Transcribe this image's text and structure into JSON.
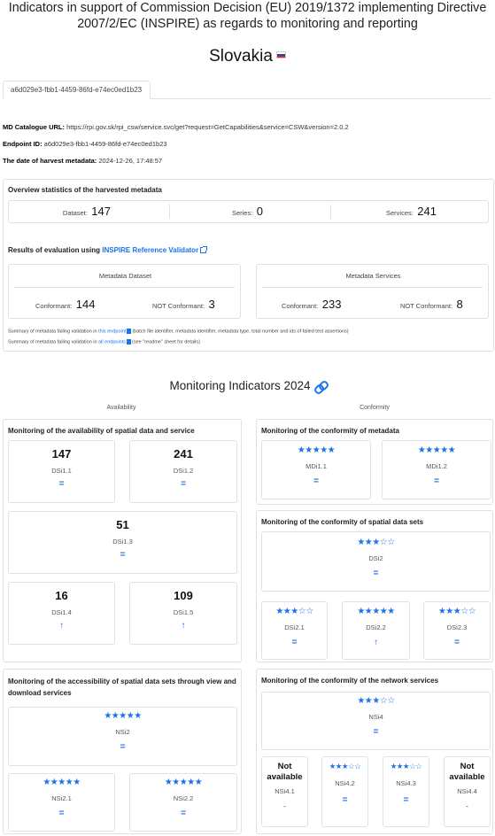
{
  "page": {
    "title": "Indicators in support of Commission Decision (EU) 2019/1372 implementing Directive 2007/2/EC (INSPIRE) as regards to monitoring and reporting",
    "country": "Slovakia"
  },
  "tab": {
    "label": "a6d029e3-fbb1-4459-86fd-e74ec0ed1b23"
  },
  "meta": {
    "md_catalogue_label": "MD Catalogue URL:",
    "md_catalogue_value": "https://rpi.gov.sk/rpi_csw/service.svc/get?request=GetCapabilities&service=CSW&version=2.0.2",
    "endpoint_label": "Endpoint ID:",
    "endpoint_value": "a6d029e3-fbb1-4459-86fd-e74ec0ed1b23",
    "harvest_label": "The date of harvest metadata:",
    "harvest_value": "2024-12-26, 17:48:57"
  },
  "overview": {
    "title": "Overview statistics of the harvested metadata",
    "dataset_label": "Dataset:",
    "dataset_value": "147",
    "series_label": "Series:",
    "series_value": "0",
    "services_label": "Services:",
    "services_value": "241"
  },
  "evaluation": {
    "title_prefix": "Results of evaluation using",
    "validator_link": "INSPIRE Reference Validator",
    "md_dataset": {
      "title": "Metadata Dataset",
      "conf_label": "Conformant:",
      "conf_value": "144",
      "nconf_label": "NOT Conformant:",
      "nconf_value": "3"
    },
    "md_services": {
      "title": "Metadata Services",
      "conf_label": "Conformant:",
      "conf_value": "233",
      "nconf_label": "NOT Conformant:",
      "nconf_value": "8"
    },
    "summary1_prefix": "Summary of metadata failing validation in",
    "summary1_link": "this endpoint",
    "summary1_suffix": "(batch file identifier, metadata identifier, metadata type, total number and ids of failed test assertions)",
    "summary2_prefix": "Summary of metadata failing validation in",
    "summary2_link": "all endpoints",
    "summary2_suffix": "(see \"readme\" sheet for details)"
  },
  "monitoring": {
    "title": "Monitoring Indicators 2024",
    "col_availability": "Availability",
    "col_conformity": "Conformity",
    "avail": {
      "title": "Monitoring of the availability of spatial data and service",
      "dsi11": {
        "value": "147",
        "name": "DSi1.1",
        "trend": "="
      },
      "dsi12": {
        "value": "241",
        "name": "DSi1.2",
        "trend": "="
      },
      "dsi13": {
        "value": "51",
        "name": "DSi1.3",
        "trend": "="
      },
      "dsi14": {
        "value": "16",
        "name": "DSi1.4",
        "trend": "↑"
      },
      "dsi15": {
        "value": "109",
        "name": "DSi1.5",
        "trend": "↑"
      }
    },
    "access": {
      "title": "Monitoring of the accessibility of spatial data sets through view and download services",
      "nsi2": {
        "stars": "★★★★★",
        "name": "NSi2",
        "trend": "="
      },
      "nsi21": {
        "stars": "★★★★★",
        "name": "NSi2.1",
        "trend": "="
      },
      "nsi22": {
        "stars": "★★★★★",
        "name": "NSi2.2",
        "trend": "="
      }
    },
    "conf_md": {
      "title": "Monitoring of the conformity of metadata",
      "mdi11": {
        "stars": "★★★★★",
        "name": "MDi1.1",
        "trend": "="
      },
      "mdi12": {
        "stars": "★★★★★",
        "name": "MDi1.2",
        "trend": "="
      }
    },
    "conf_ds": {
      "title": "Monitoring of the conformity of spatial data sets",
      "dsi2": {
        "stars": "★★★☆☆",
        "name": "DSi2",
        "trend": "="
      },
      "dsi21": {
        "stars": "★★★☆☆",
        "name": "DSi2.1",
        "trend": "="
      },
      "dsi22": {
        "stars": "★★★★★",
        "name": "DSi2.2",
        "trend": "↑"
      },
      "dsi23": {
        "stars": "★★★☆☆",
        "name": "DSi2.3",
        "trend": "="
      }
    },
    "conf_ns": {
      "title": "Monitoring of the conformity of the network services",
      "nsi4": {
        "stars": "★★★☆☆",
        "name": "NSi4",
        "trend": "="
      },
      "nsi41": {
        "na": "Not available",
        "name": "NSi4.1",
        "trend": "-"
      },
      "nsi42": {
        "stars": "★★★☆☆",
        "name": "NSi4.2",
        "trend": "="
      },
      "nsi43": {
        "stars": "★★★☆☆",
        "name": "NSi4.3",
        "trend": "="
      },
      "nsi44": {
        "na": "Not available",
        "name": "NSi4.4",
        "trend": "-"
      }
    }
  },
  "colors": {
    "accent": "#1a73e8",
    "border": "#dee2e6"
  }
}
